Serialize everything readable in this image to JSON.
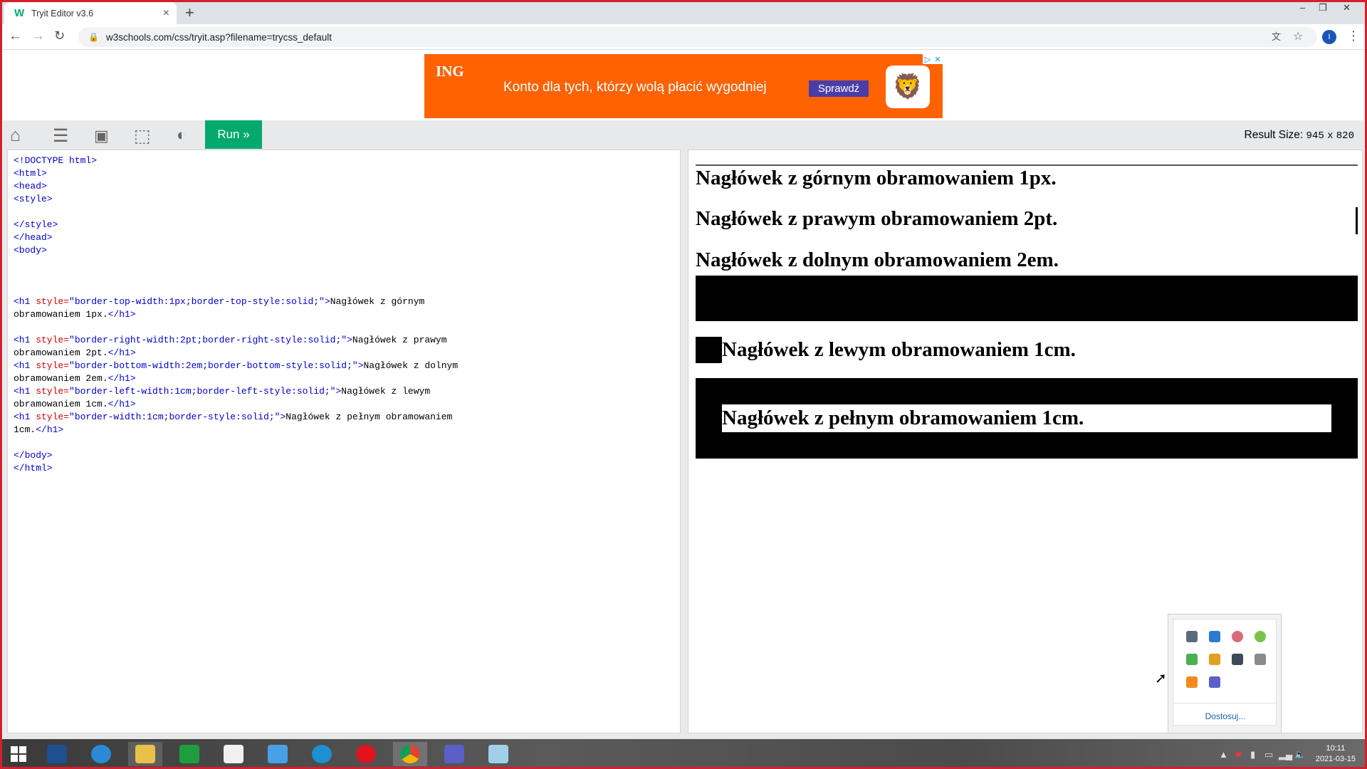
{
  "browser": {
    "tab_title": "Tryit Editor v3.6",
    "tab_favicon": "W",
    "tab_close": "×",
    "new_tab": "+",
    "url": "w3schools.com/css/tryit.asp?filename=trycss_default",
    "profile_initial": "I",
    "window_controls": [
      "–",
      "❐",
      "✕"
    ]
  },
  "ad": {
    "brand": "ING",
    "text": "Konto dla tych, którzy wolą płacić wygodniej",
    "cta": "Sprawdź",
    "colors": {
      "background": "#ff6200",
      "cta": "#4a3da8"
    }
  },
  "toolbar": {
    "icons": [
      "home-icon",
      "menu-icon",
      "save-icon",
      "rotate-icon",
      "contrast-icon"
    ],
    "run_label": "Run »",
    "result_size_label": "Result Size:",
    "result_width": "945",
    "result_x": "x",
    "result_height": "820",
    "colors": {
      "run": "#04aa6d"
    }
  },
  "code": {
    "l1": "<!DOCTYPE html>",
    "l2": "<html>",
    "l3": "<head>",
    "l4": "<style>",
    "l5": "</style>",
    "l6": "</head>",
    "l7": "<body>",
    "h1_open": "<h1",
    "style_attr": " style=",
    "tag_close": ">",
    "h1_close": "</h1>",
    "s1": "\"border-top-width:1px;border-top-style:solid;\"",
    "t1a": "Nagłówek z górnym",
    "t1b": "obramowaniem 1px.",
    "s2": "\"border-right-width:2pt;border-right-style:solid;\"",
    "t2a": "Nagłówek z prawym",
    "t2b": "obramowaniem 2pt.",
    "s3": "\"border-bottom-width:2em;border-bottom-style:solid;\"",
    "t3a": "Nagłówek z dolnym",
    "t3b": "obramowaniem 2em.",
    "s4": "\"border-left-width:1cm;border-left-style:solid;\"",
    "t4a": "Nagłówek z lewym",
    "t4b": "obramowaniem 1cm.",
    "s5": "\"border-width:1cm;border-style:solid;\"",
    "t5a": "Nagłówek z pełnym obramowaniem",
    "t5b": "1cm.",
    "l_body_close": "</body>",
    "l_html_close": "</html>"
  },
  "result": {
    "h1_top": "Nagłówek z górnym obramowaniem 1px.",
    "h1_right": "Nagłówek z prawym obramowaniem 2pt.",
    "h1_bottom": "Nagłówek z dolnym obramowaniem 2em.",
    "h1_left": "Nagłówek z lewym obramowaniem 1cm.",
    "h1_full": "Nagłówek z pełnym obramowaniem 1cm."
  },
  "tray": {
    "customize_link": "Dostosuj..."
  },
  "taskbar": {
    "time": "10:11",
    "date": "2021-03-15"
  }
}
